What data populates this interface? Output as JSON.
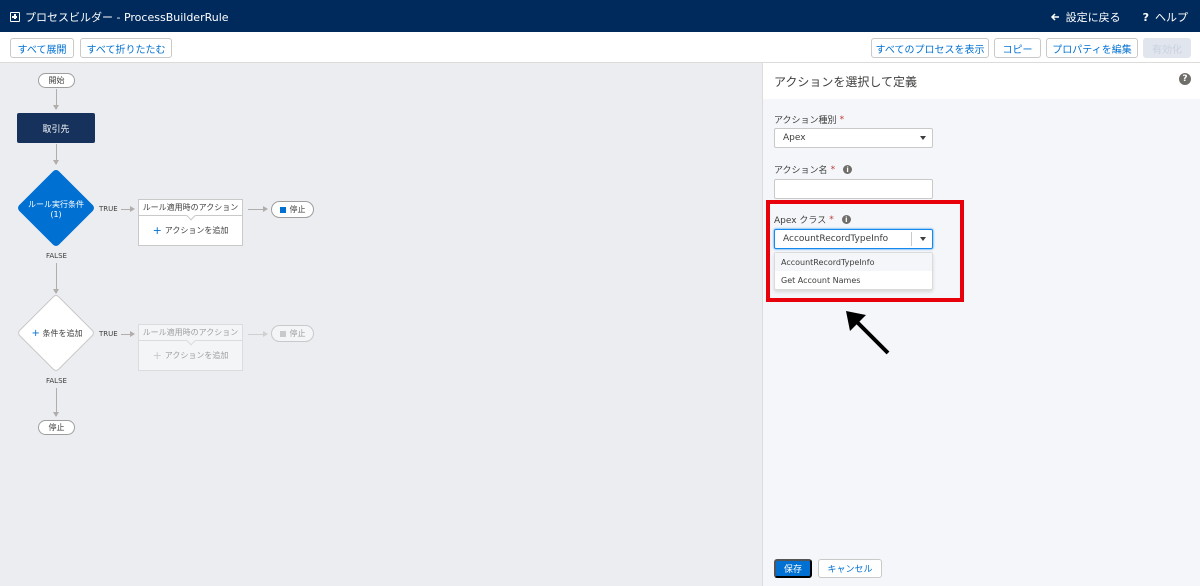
{
  "header": {
    "title": "プロセスビルダー - ProcessBuilderRule",
    "back_label": "設定に戻る",
    "help_label": "ヘルプ"
  },
  "toolbar": {
    "expand_all": "すべて展開",
    "collapse_all": "すべて折りたたむ",
    "view_all_processes": "すべてのプロセスを表示",
    "copy": "コピー",
    "edit_properties": "プロパティを編集",
    "activate": "有効化"
  },
  "canvas": {
    "start_label": "開始",
    "object_label": "取引先",
    "criteria1_label": "ルール実行条件",
    "criteria1_sub": "(1)",
    "true_label": "TRUE",
    "false_label": "FALSE",
    "immediate_actions_label": "ルール適用時のアクション",
    "add_action_label": "アクションを追加",
    "stop_label": "停止",
    "add_criteria_label": "条件を追加"
  },
  "panel": {
    "title": "アクションを選択して定義",
    "action_type_label": "アクション種別",
    "action_type_value": "Apex",
    "action_name_label": "アクション名",
    "action_name_value": "",
    "apex_class_label": "Apex クラス",
    "apex_class_value": "AccountRecordTypeInfo",
    "options": [
      "AccountRecordTypeInfo",
      "Get Account Names"
    ],
    "required_mark": "*",
    "save_label": "保存",
    "cancel_label": "キャンセル"
  },
  "colors": {
    "header_bg": "#002a5c",
    "brand_blue": "#0070d2",
    "object_bg": "#16325c",
    "highlight_red": "#e8000b"
  }
}
